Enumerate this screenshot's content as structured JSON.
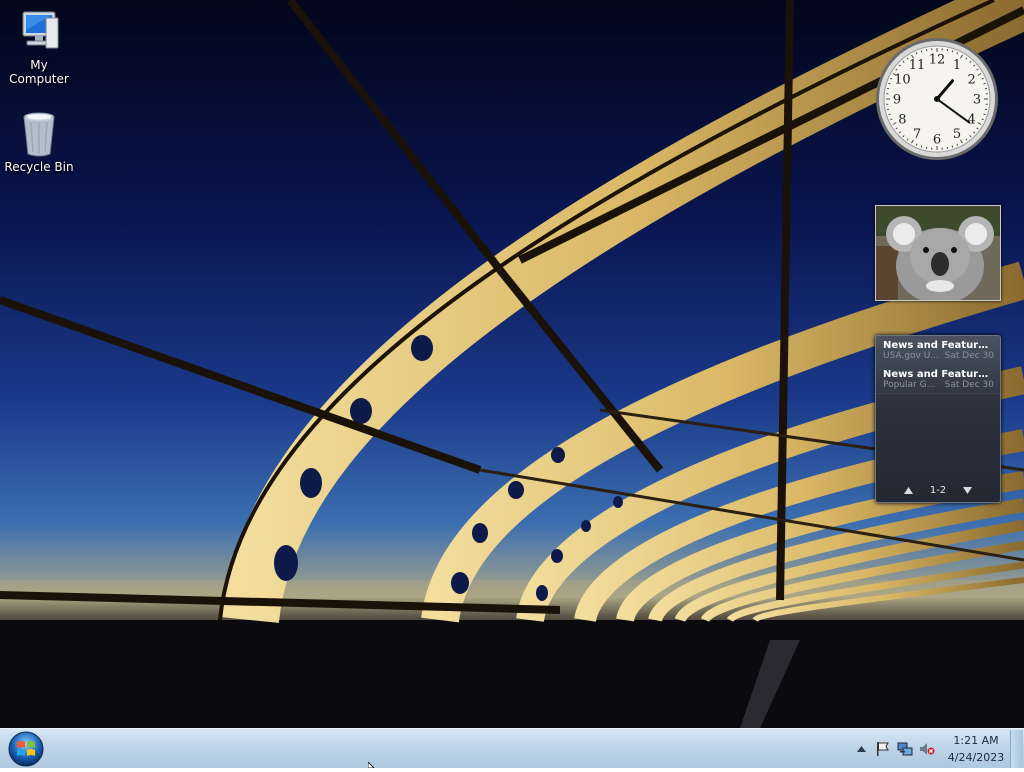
{
  "desktop": {
    "icons": [
      {
        "label": "My Computer",
        "icon": "computer-icon"
      },
      {
        "label": "Recycle Bin",
        "icon": "recycle-bin-icon"
      }
    ]
  },
  "gadgets": {
    "clock": {
      "numerals": [
        "12",
        "1",
        "2",
        "3",
        "4",
        "5",
        "6",
        "7",
        "8",
        "9",
        "10",
        "11"
      ],
      "time": "1:21"
    },
    "slideshow": {
      "subject": "koala photo"
    },
    "feeds": {
      "items": [
        {
          "title": "News and Features f...",
          "source": "USA.gov U...",
          "date": "Sat Dec 30"
        },
        {
          "title": "News and Features f...",
          "source": "Popular G...",
          "date": "Sat Dec 30"
        }
      ],
      "pager": "1-2"
    }
  },
  "taskbar": {
    "start_icon": "windows-logo-icon",
    "tray": {
      "icons": [
        "show-hidden-icons-icon",
        "action-center-flag-icon",
        "network-icon",
        "volume-muted-icon"
      ],
      "time": "1:21 AM",
      "date": "4/24/2023"
    }
  }
}
